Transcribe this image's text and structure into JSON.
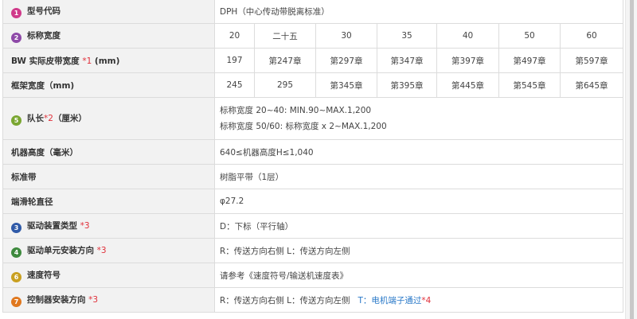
{
  "badge_colors": {
    "1": "#d03a8a",
    "2": "#8e4aa8",
    "3": "#2f5aa8",
    "4": "#3e8a3e",
    "5": "#7aa631",
    "6": "#c9a020",
    "7": "#e0781e"
  },
  "rows": {
    "model": {
      "badge": "1",
      "label": "型号代码",
      "value": "DPH（中心传动带脱离标准）"
    },
    "nominal": {
      "badge": "2",
      "label": "标称宽度",
      "values": [
        "20",
        "二十五",
        "30",
        "35",
        "40",
        "50",
        "60"
      ]
    },
    "bw": {
      "label": "BW 实际皮带宽度",
      "note": "*1",
      "unit": "(mm)",
      "values": [
        "197",
        "第247章",
        "第297章",
        "第347章",
        "第397章",
        "第497章",
        "第597章"
      ]
    },
    "frame": {
      "label": "框架宽度（mm)",
      "values": [
        "245",
        "295",
        "第345章",
        "第395章",
        "第445章",
        "第545章",
        "第645章"
      ]
    },
    "length": {
      "badge": "5",
      "label": "队长",
      "note": "*2",
      "unit": "（厘米）",
      "line1": "标称宽度 20~40: MIN.90~MAX.1,200",
      "line2": "标称宽度 50/60: 标称宽度 x 2~MAX.1,200"
    },
    "height": {
      "label": "机器高度（毫米）",
      "value": "640≤机器高度H≤1,040"
    },
    "belt": {
      "label": "标准带",
      "value": "树脂平带（1层）"
    },
    "pulley": {
      "label": "端滑轮直径",
      "value": "φ27.2"
    },
    "drive": {
      "badge": "3",
      "label": "驱动装置类型",
      "note": "*3",
      "value": "D：下标（平行轴）"
    },
    "mount": {
      "badge": "4",
      "label": "驱动单元安装方向",
      "note": "*3",
      "value": "R：传送方向右侧 L：传送方向左侧"
    },
    "speed": {
      "badge": "6",
      "label": "速度符号",
      "value": "请参考《速度符号/输送机速度表》"
    },
    "controller": {
      "badge": "7",
      "label": "控制器安装方向",
      "note": "*3",
      "value": "R：传送方向右侧 L：传送方向左侧",
      "link": "T：电机端子通过",
      "link_note": "*4"
    }
  }
}
